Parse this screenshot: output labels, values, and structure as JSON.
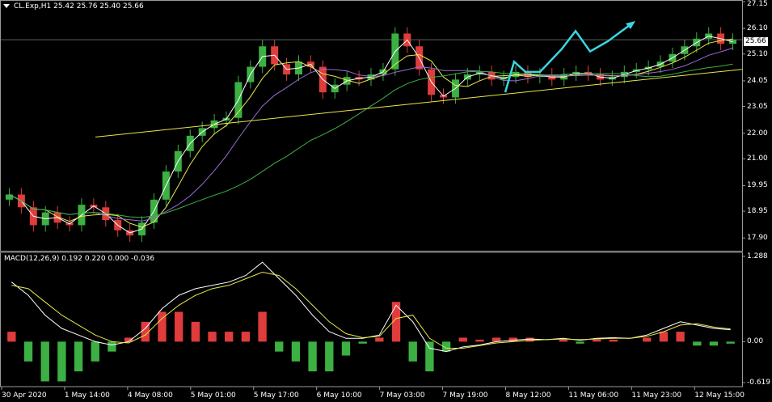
{
  "chart_data": {
    "type": "candlestick",
    "symbol_header": "CL.Exp,H1  25.42 25.76 25.40 25.66",
    "current_price_label": "25.66",
    "price_axis": {
      "ylim": [
        17.4,
        27.15
      ],
      "ticks": [
        "27.15",
        "26.10",
        "25.10",
        "24.05",
        "23.05",
        "22.00",
        "21.00",
        "19.95",
        "18.95",
        "17.90"
      ]
    },
    "time_axis_labels": [
      "30 Apr 2020",
      "1 May 14:00",
      "4 May 08:00",
      "5 May 01:00",
      "5 May 17:00",
      "6 May 10:00",
      "7 May 03:00",
      "7 May 19:00",
      "8 May 12:00",
      "11 May 06:00",
      "11 May 23:00",
      "12 May 15:00"
    ],
    "close_path": [
      19.6,
      19.1,
      18.4,
      18.9,
      18.5,
      18.4,
      19.2,
      19.1,
      18.6,
      18.2,
      18.0,
      18.5,
      19.4,
      20.5,
      21.3,
      21.9,
      22.2,
      22.5,
      22.6,
      24.0,
      24.6,
      25.4,
      24.7,
      24.3,
      24.8,
      24.6,
      23.6,
      23.9,
      24.2,
      24.1,
      24.3,
      24.5,
      25.9,
      25.4,
      24.5,
      23.5,
      23.4,
      24.1,
      24.3,
      24.4,
      24.1,
      24.2,
      24.4,
      24.2,
      24.3,
      24.1,
      24.3,
      24.4,
      24.3,
      24.1,
      24.2,
      24.4,
      24.5,
      24.6,
      24.8,
      25.1,
      25.4,
      25.7,
      25.9,
      25.5,
      25.66
    ],
    "indicator_lines": [
      {
        "name": "fast MA",
        "color": "#ffffff"
      },
      {
        "name": "medium MA",
        "color": "#e8e84a"
      },
      {
        "name": "slow MA",
        "color": "#9b6bd8"
      },
      {
        "name": "long MA",
        "color": "#3cb043"
      }
    ],
    "trendline_color": "#e8e84a",
    "projection_arrow_color": "#3bd6e0",
    "macd": {
      "header": "MACD(12,26,9) 0.192 0.220 0.000 -0.036",
      "ylim": [
        -0.619,
        1.288
      ],
      "ticks": [
        "1.288",
        "0.00",
        "-0.619"
      ],
      "macd_path": [
        0.9,
        0.7,
        0.4,
        0.2,
        0.1,
        0.0,
        -0.05,
        0.0,
        0.2,
        0.5,
        0.7,
        0.8,
        0.85,
        0.9,
        1.0,
        1.2,
        0.95,
        0.7,
        0.4,
        0.15,
        0.05,
        0.05,
        0.1,
        0.55,
        0.3,
        -0.1,
        -0.15,
        -0.08,
        -0.05,
        0.0,
        0.02,
        0.04,
        0.03,
        0.05,
        0.02,
        0.05,
        0.06,
        0.05,
        0.1,
        0.2,
        0.3,
        0.25,
        0.2,
        0.18
      ],
      "signal_path": [
        0.85,
        0.8,
        0.6,
        0.4,
        0.25,
        0.1,
        0.0,
        -0.02,
        0.1,
        0.35,
        0.55,
        0.7,
        0.8,
        0.85,
        0.95,
        1.05,
        1.0,
        0.8,
        0.55,
        0.3,
        0.12,
        0.06,
        0.08,
        0.35,
        0.4,
        0.05,
        -0.1,
        -0.1,
        -0.06,
        -0.02,
        0.0,
        0.02,
        0.03,
        0.04,
        0.03,
        0.04,
        0.05,
        0.05,
        0.08,
        0.15,
        0.25,
        0.27,
        0.22,
        0.19
      ],
      "hist_colors": {
        "positive": "#e03c3c",
        "negative": "#3cb043"
      }
    }
  }
}
